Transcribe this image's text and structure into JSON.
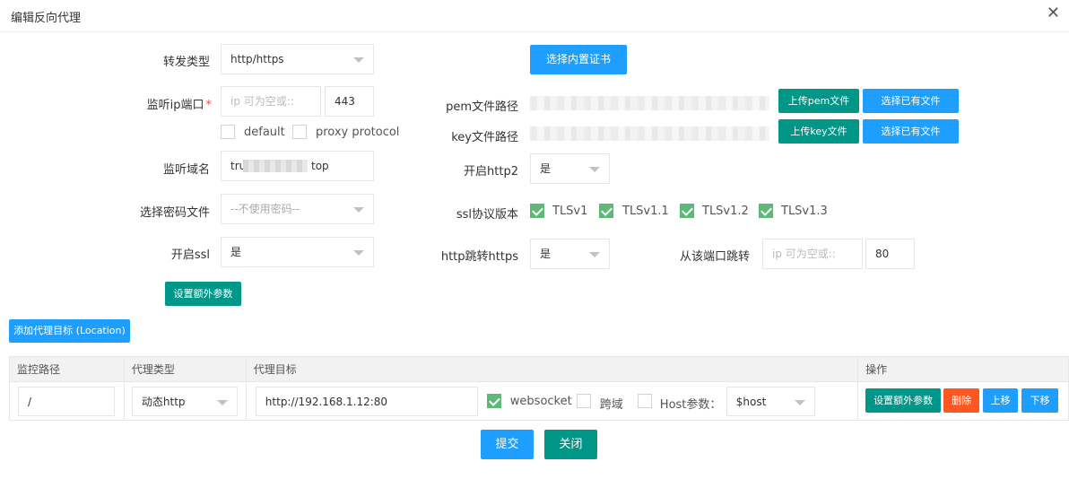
{
  "dialog": {
    "title": "编辑反向代理",
    "close_glyph": "✕"
  },
  "form": {
    "forward_type": {
      "label": "转发类型",
      "value": "http/https"
    },
    "listen": {
      "label": "监听ip端口",
      "required_mark": "*",
      "ip_placeholder": "ip 可为空或::",
      "port": "443"
    },
    "default_check": {
      "label": "default",
      "checked": false
    },
    "proxy_protocol_check": {
      "label": "proxy protocol",
      "checked": false
    },
    "domain": {
      "label": "监听域名",
      "value_start": "tru",
      "value_end": "top"
    },
    "password_file": {
      "label": "选择密码文件",
      "placeholder": "--不使用密码--"
    },
    "ssl": {
      "label": "开启ssl",
      "value": "是"
    },
    "extra_params_button": "设置额外参数",
    "builtin_cert_button": "选择内置证书",
    "pem": {
      "label": "pem文件路径",
      "upload_button": "上传pem文件",
      "choose_button": "选择已有文件"
    },
    "key": {
      "label": "key文件路径",
      "upload_button": "上传key文件",
      "choose_button": "选择已有文件"
    },
    "http2": {
      "label": "开启http2",
      "value": "是"
    },
    "ssl_protocols": {
      "label": "ssl协议版本",
      "items": [
        {
          "label": "TLSv1",
          "checked": true
        },
        {
          "label": "TLSv1.1",
          "checked": true
        },
        {
          "label": "TLSv1.2",
          "checked": true
        },
        {
          "label": "TLSv1.3",
          "checked": true
        }
      ]
    },
    "http_redirect": {
      "label": "http跳转https",
      "value": "是"
    },
    "redirect_port": {
      "label": "从该端口跳转",
      "ip_placeholder": "ip 可为空或::",
      "port": "80"
    }
  },
  "add_location_button": "添加代理目标 (Location)",
  "table": {
    "headers": [
      "监控路径",
      "代理类型",
      "代理目标",
      "操作"
    ],
    "row": {
      "path": "/",
      "type": "动态http",
      "target": "http://192.168.1.12:80",
      "websocket": {
        "label": "websocket",
        "checked": true
      },
      "cors": {
        "label": "跨域",
        "checked": false
      },
      "host_param": {
        "label": "Host参数：",
        "checked": false,
        "value": "$host"
      },
      "actions": {
        "extra": "设置额外参数",
        "delete": "删除",
        "up": "上移",
        "down": "下移"
      }
    }
  },
  "footer": {
    "submit": "提交",
    "close": "关闭"
  }
}
